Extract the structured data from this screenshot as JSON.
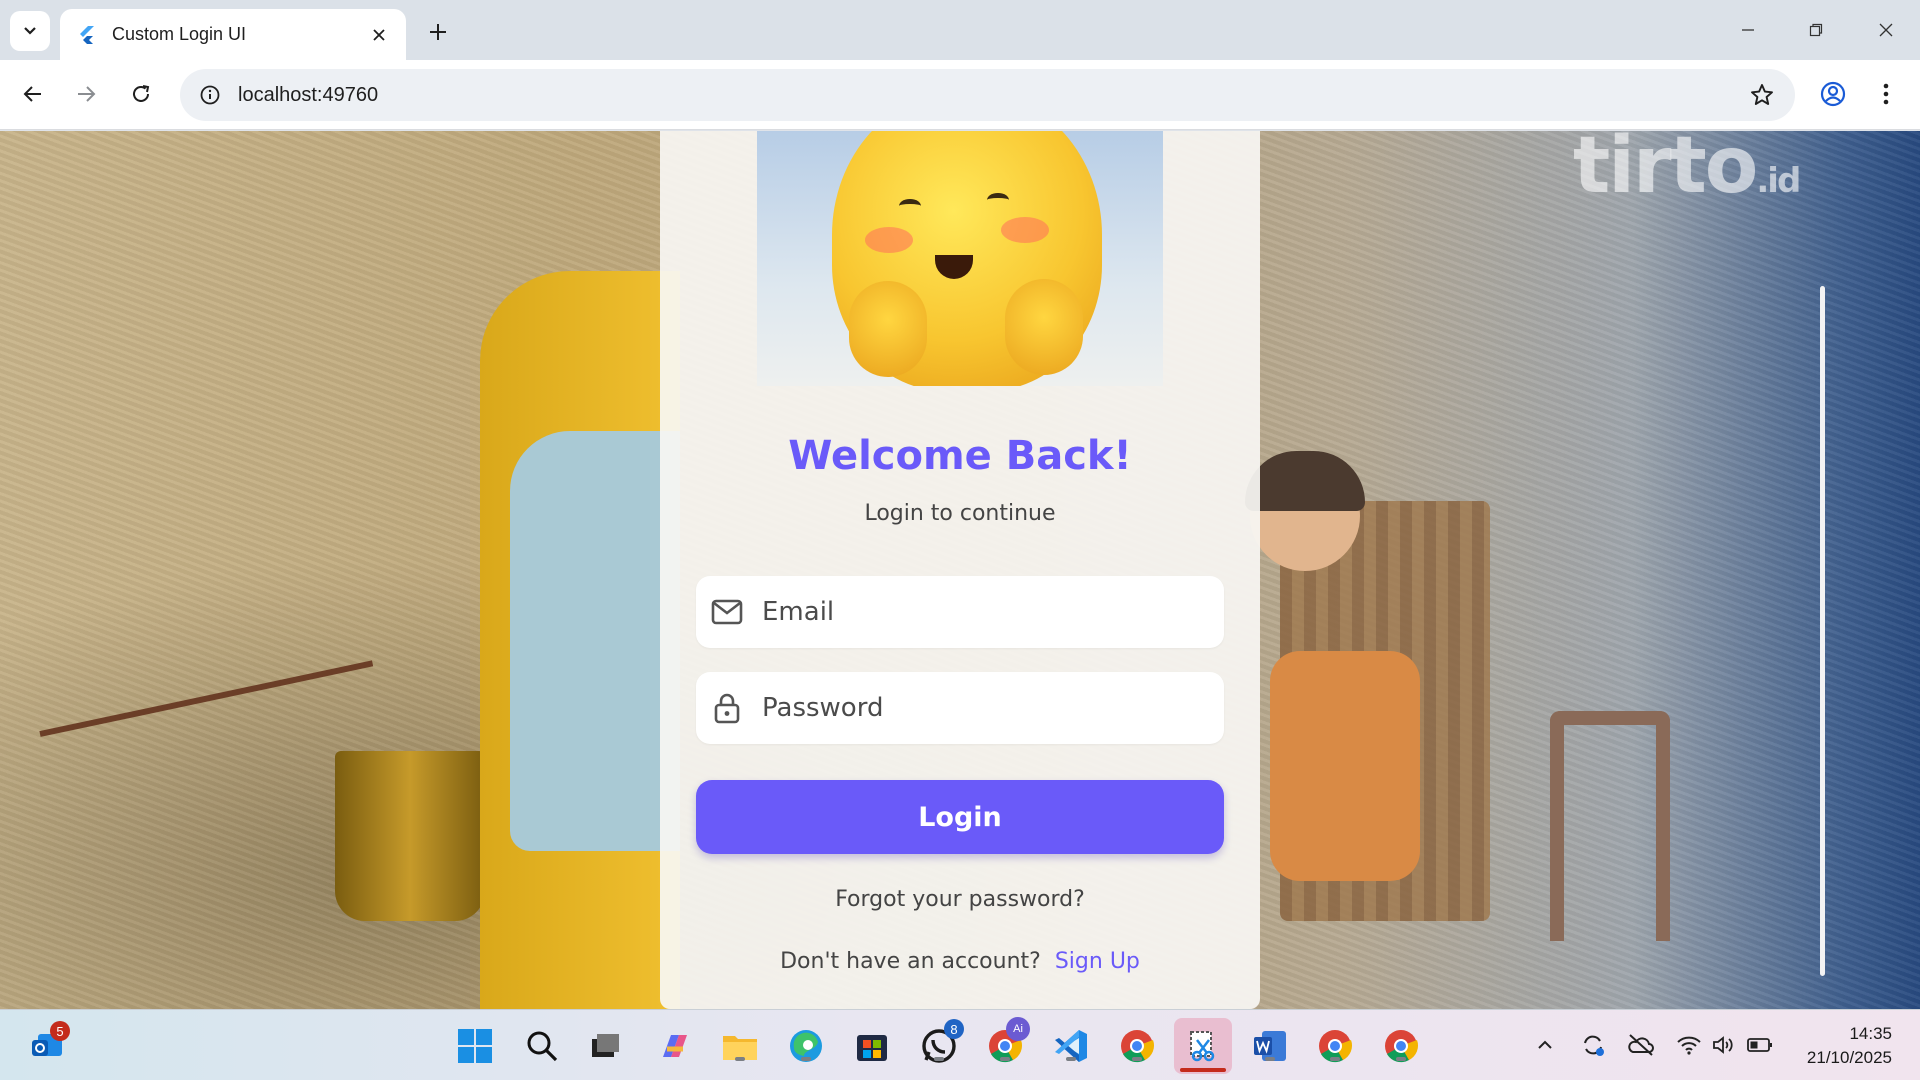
{
  "browser": {
    "tab_title": "Custom Login UI",
    "url": "localhost:49760"
  },
  "page": {
    "heading": "Welcome Back!",
    "subheading": "Login to continue",
    "email_placeholder": "Email",
    "password_placeholder": "Password",
    "login_label": "Login",
    "forgot_label": "Forgot your password?",
    "no_account_label": "Don't have an account?",
    "signup_label": "Sign Up",
    "background_watermark": "tirto",
    "background_watermark_suffix": ".id",
    "accent_color": "#6a5af9"
  },
  "taskbar": {
    "apps": [
      {
        "name": "outlook",
        "badge": "5"
      },
      {
        "name": "start"
      },
      {
        "name": "search"
      },
      {
        "name": "task-view"
      },
      {
        "name": "copilot"
      },
      {
        "name": "file-explorer"
      },
      {
        "name": "edge"
      },
      {
        "name": "store"
      },
      {
        "name": "whatsapp",
        "badge": "8"
      },
      {
        "name": "chrome-ai"
      },
      {
        "name": "vscode"
      },
      {
        "name": "chrome"
      },
      {
        "name": "snipping-tool"
      },
      {
        "name": "word"
      },
      {
        "name": "chrome"
      },
      {
        "name": "chrome"
      }
    ],
    "time": "14:35",
    "date": "21/10/2025"
  }
}
